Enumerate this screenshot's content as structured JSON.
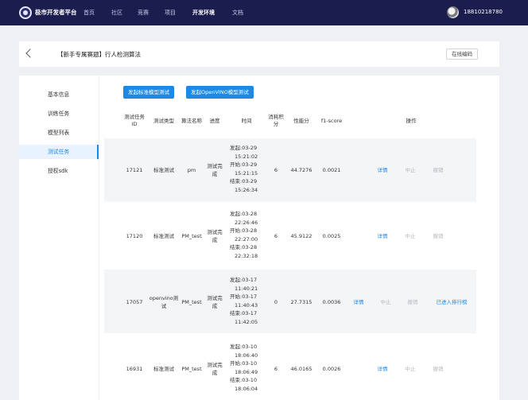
{
  "nav": {
    "brand": "极市开发者平台",
    "items": [
      "首页",
      "社区",
      "竞赛",
      "项目",
      "开发环境",
      "文档"
    ],
    "active_index": 4,
    "user": "18810218780"
  },
  "header": {
    "title": "【新手专属赛题】行人检测算法",
    "online_code_label": "在线编码"
  },
  "sidebar": {
    "items": [
      "基本信息",
      "训练任务",
      "模型列表",
      "测试任务",
      "授权sdk"
    ],
    "active_index": 3
  },
  "actions": {
    "standard_test": "发起标准模型测试",
    "openvino_test": "发起OpenVINO模型测试"
  },
  "table": {
    "headers": {
      "id_line1": "测试任务",
      "id_line2": "ID",
      "type": "测试类型",
      "algo": "算法名称",
      "progress": "进度",
      "time": "时间",
      "score_line1": "消耗积",
      "score_line2": "分",
      "perf": "性能分",
      "f1": "f1-score",
      "ops": "操作"
    },
    "rows": [
      {
        "id": "17121",
        "type_lines": [
          "标准测试"
        ],
        "algo": "pm",
        "progress_lines": [
          "测试完",
          "成"
        ],
        "time_lines": [
          "发起:03-29",
          "15:21:02",
          "开始:03-29",
          "15:21:15",
          "结束:03-29",
          "15:26:34"
        ],
        "score": "6",
        "perf": "44.7276",
        "f1": "0.0021",
        "op_detail": "详情",
        "op_stop": "中止",
        "op_revoke": "撤销",
        "op_extra": ""
      },
      {
        "id": "17120",
        "type_lines": [
          "标准测试"
        ],
        "algo": "PM_test",
        "progress_lines": [
          "测试完",
          "成"
        ],
        "time_lines": [
          "发起:03-28",
          "22:26:46",
          "开始:03-28",
          "22:27:00",
          "结束:03-28",
          "22:32:18"
        ],
        "score": "6",
        "perf": "45.9122",
        "f1": "0.0025",
        "op_detail": "详情",
        "op_stop": "中止",
        "op_revoke": "撤销",
        "op_extra": ""
      },
      {
        "id": "17057",
        "type_lines": [
          "openvino测",
          "试"
        ],
        "algo": "PM_test",
        "progress_lines": [
          "测试完",
          "成"
        ],
        "time_lines": [
          "发起:03-17",
          "11:40:21",
          "开始:03-17",
          "11:40:43",
          "结束:03-17",
          "11:42:05"
        ],
        "score": "0",
        "perf": "27.7315",
        "f1": "0.0036",
        "op_detail": "详情",
        "op_stop": "中止",
        "op_revoke": "撤销",
        "op_extra": "已进入排行榜"
      },
      {
        "id": "16931",
        "type_lines": [
          "标准测试"
        ],
        "algo": "PM_test",
        "progress_lines": [
          "测试完",
          "成"
        ],
        "time_lines": [
          "发起:03-10",
          "18:06:40",
          "开始:03-10",
          "18:06:49",
          "结束:03-10",
          "18:06:04"
        ],
        "score": "6",
        "perf": "46.0165",
        "f1": "0.0026",
        "op_detail": "详情",
        "op_stop": "中止",
        "op_revoke": "撤销",
        "op_extra": ""
      }
    ]
  },
  "colors": {
    "nav_bg": "#1a1d4e",
    "accent": "#1e88e5",
    "row_band": "#f4f5f7"
  }
}
